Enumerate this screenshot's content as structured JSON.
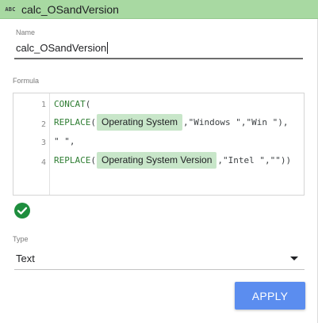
{
  "header": {
    "type_icon_text": "ABC",
    "title": "calc_OSandVersion",
    "background_color": "#a8d9a2"
  },
  "name_field": {
    "label": "Name",
    "value": "calc_OSandVersion"
  },
  "formula": {
    "label": "Formula",
    "lines": [
      {
        "number": "1",
        "fn": "CONCAT",
        "open": "("
      },
      {
        "number": "2",
        "fn": "REPLACE",
        "open": "(",
        "field": "Operating System",
        "args": ",\"Windows \",\"Win \"),"
      },
      {
        "number": "3",
        "text": "\" \","
      },
      {
        "number": "4",
        "fn": "REPLACE",
        "open": "(",
        "field": "Operating System Version",
        "args": ",\"Intel \",\"\"))"
      }
    ],
    "field_chip_color": "#c8e6c9"
  },
  "validation": {
    "icon": "check-circle-icon",
    "status_color": "#1e8e3e"
  },
  "type_field": {
    "label": "Type",
    "selected": "Text"
  },
  "actions": {
    "apply_label": "APPLY",
    "apply_color": "#5b8def"
  }
}
